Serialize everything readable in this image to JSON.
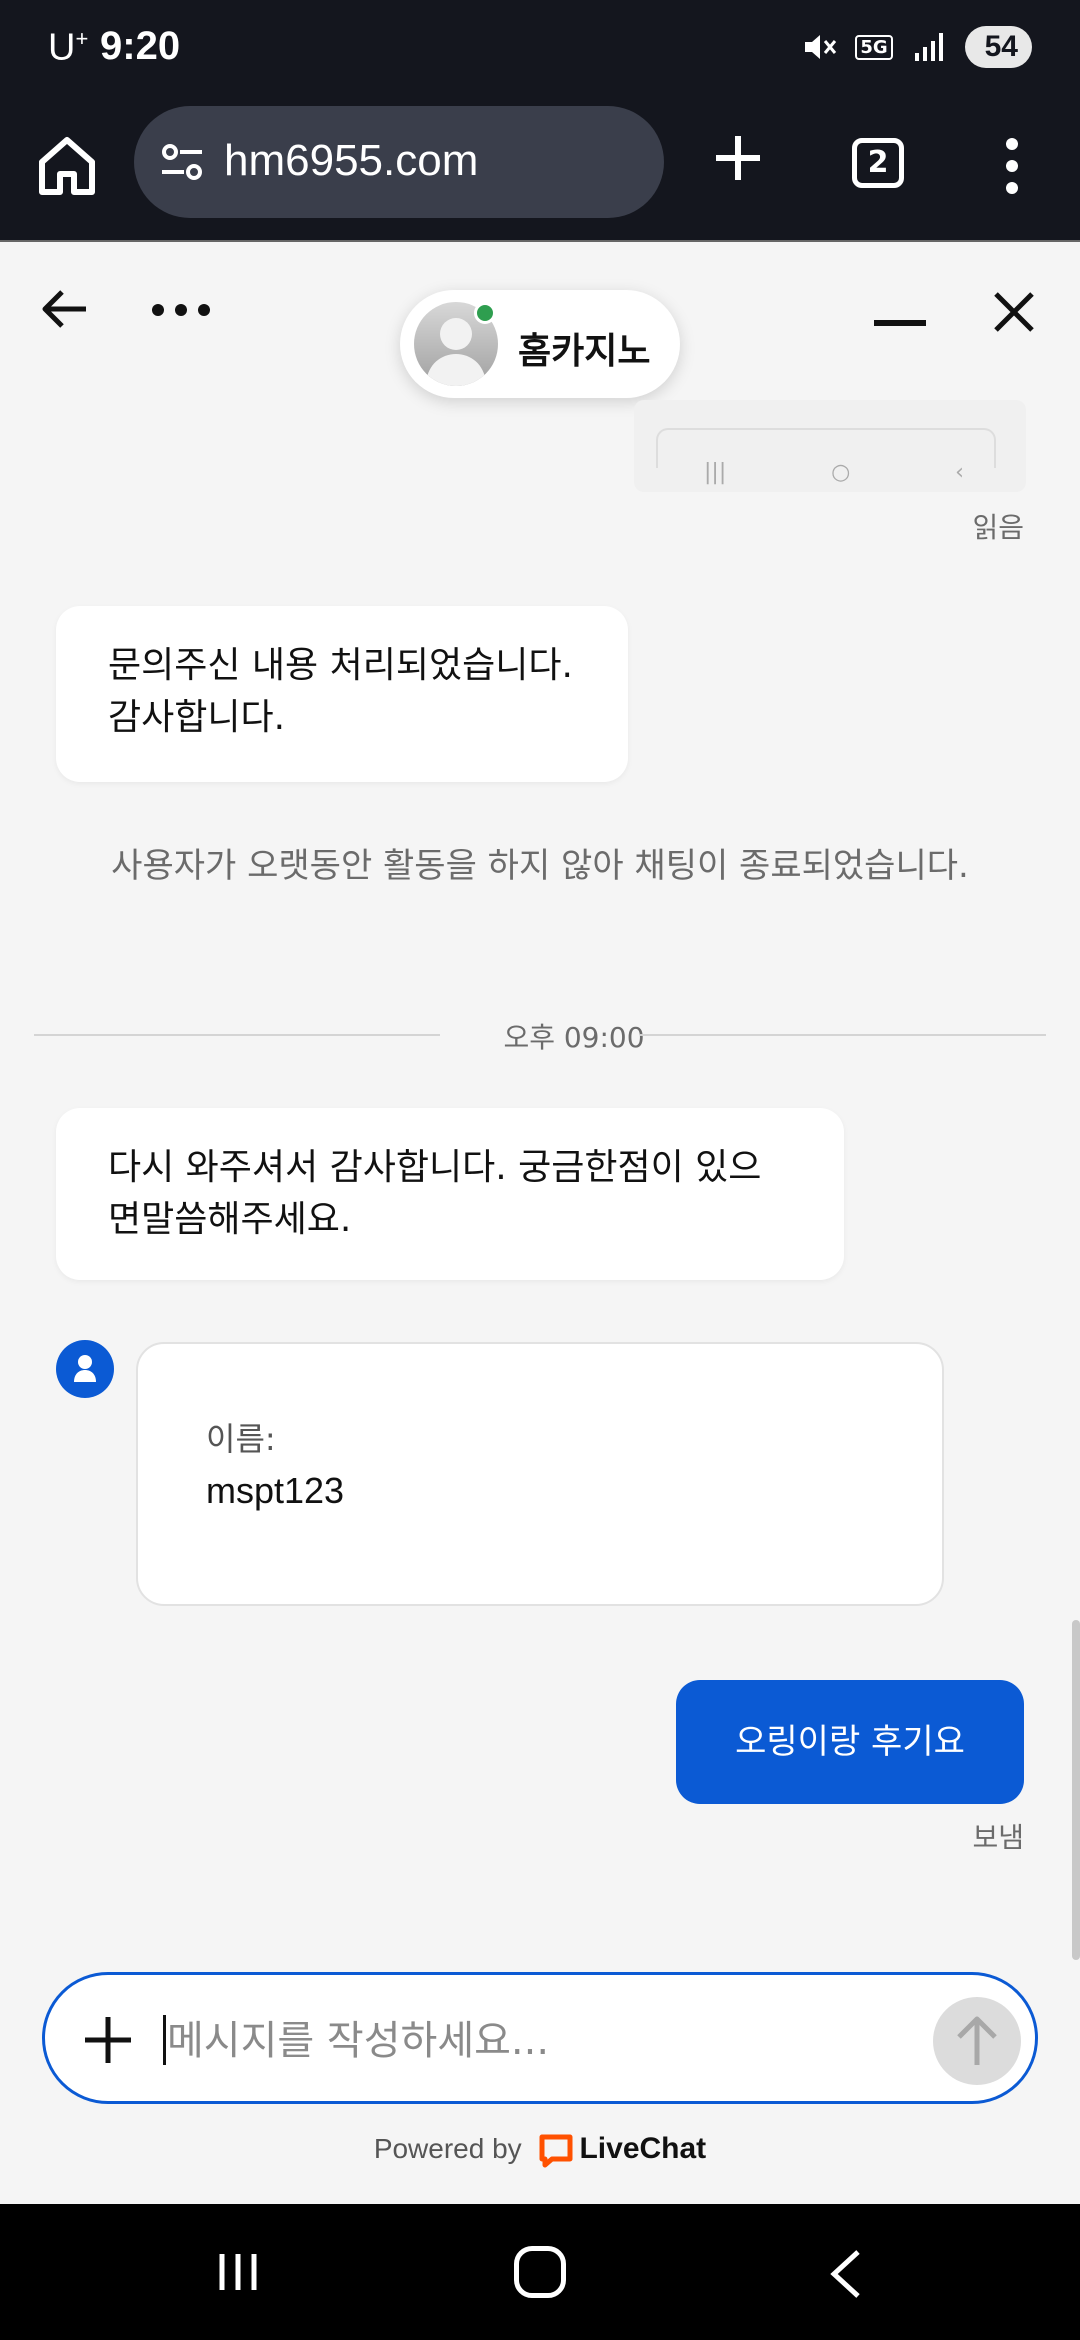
{
  "status_bar": {
    "carrier": "U",
    "carrier_sup": "+",
    "time": "9:20",
    "network": "5G",
    "battery": "54"
  },
  "browser": {
    "url": "hm6955.com",
    "tab_count": "2"
  },
  "chat": {
    "agent_name": "홈카지노",
    "read_status": "읽음",
    "messages": [
      {
        "line1": "문의주신 내용 처리되었습니다.",
        "line2": "감사합니다."
      },
      {
        "line1": "다시 와주셔서 감사합니다. 궁금한점이 있으",
        "line2": "면말씀해주세요."
      }
    ],
    "system_message": "사용자가 오랫동안 활동을 하지 않아 채팅이 종료되었습니다.",
    "divider_time": "오후 09:00",
    "form": {
      "label": "이름:",
      "value": "mspt123"
    },
    "sent_message": "오링이랑 후기요",
    "sent_status": "보냄",
    "composer_placeholder": "메시지를 작성하세요...",
    "powered_by": "Powered by",
    "brand": "LiveChat"
  },
  "colors": {
    "accent": "#0b5ad4",
    "online": "#2e9e4f",
    "brand_orange": "#ff5100"
  }
}
